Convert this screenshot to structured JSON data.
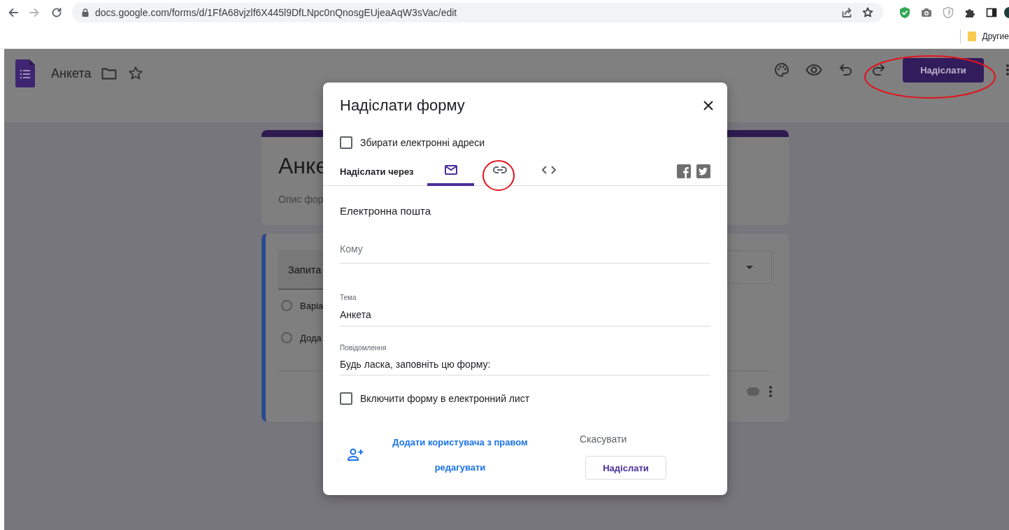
{
  "browser": {
    "url": "docs.google.com/forms/d/1FfA68vjzlf6X445l9DfLNpc0nQnosgEUjeaAqW3sVac/edit",
    "bookmark": "Другие"
  },
  "header": {
    "title": "Анкета",
    "send_button": "Надіслати"
  },
  "form_background": {
    "title": "Анке",
    "description": "Опис фор",
    "question": "Запита",
    "options": [
      {
        "text": "Варіа",
        "selected": false
      },
      {
        "text": "Дода",
        "selected": false
      }
    ],
    "required_toggle": {
      "on": false
    }
  },
  "dialog": {
    "title": "Надіслати форму",
    "collect_emails": {
      "label": "Збирати електронні адреси",
      "checked": false
    },
    "send_via_label": "Надіслати через",
    "tabs": [
      {
        "kind": "email",
        "selected": true
      },
      {
        "kind": "link",
        "selected": false
      },
      {
        "kind": "embed",
        "selected": false
      }
    ],
    "section_title": "Електронна пошта",
    "fields": [
      {
        "placeholder": "Кому"
      },
      {
        "label": "Тема",
        "value": "Анкета"
      },
      {
        "label": "Повідомлення",
        "value": "Будь ласка, заповніть цю форму:"
      }
    ],
    "include_form": {
      "label": "Включити форму в електронний лист",
      "checked": false
    },
    "add_editor_link": "Додати користувача з правом редагувати",
    "cancel": "Скасувати",
    "send": "Надіслати"
  }
}
